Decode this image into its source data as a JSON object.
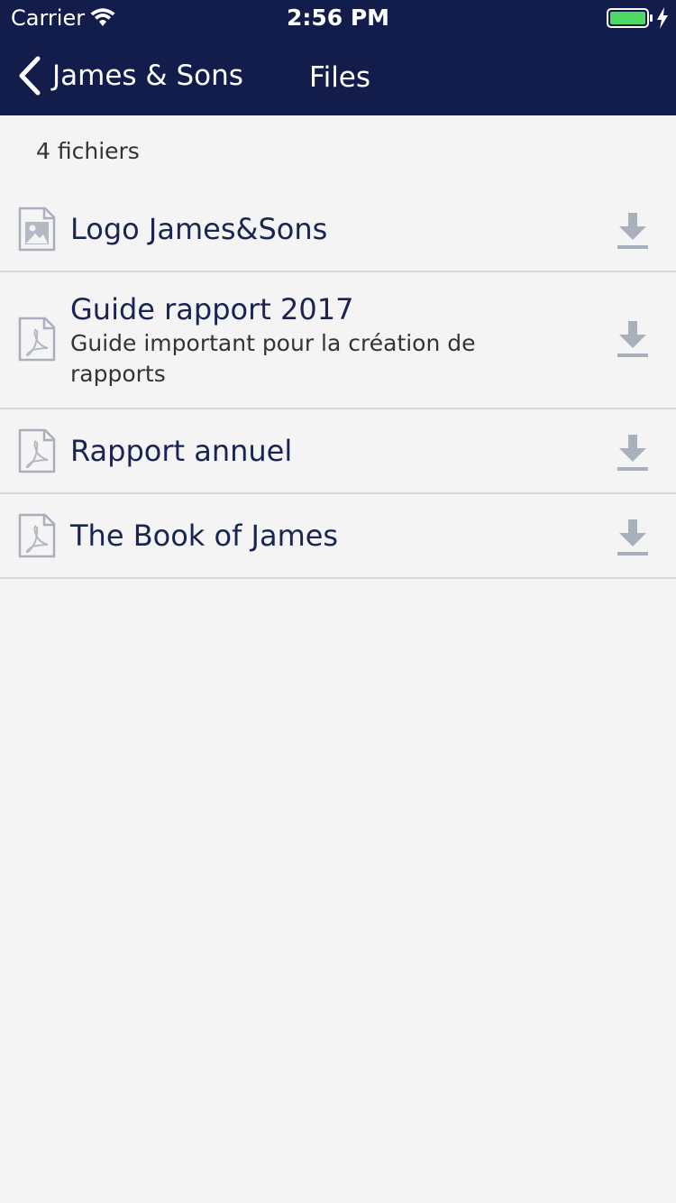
{
  "status_bar": {
    "carrier": "Carrier",
    "time": "2:56 PM",
    "battery_color": "#4cd964"
  },
  "nav": {
    "back_label": "James & Sons",
    "title": "Files",
    "background": "#121d4c"
  },
  "files": {
    "count_label": "4 fichiers",
    "items": [
      {
        "title": "Logo James&Sons",
        "description": "",
        "icon": "image-file-icon"
      },
      {
        "title": "Guide rapport 2017",
        "description": "Guide important pour la création de rapports",
        "icon": "pdf-file-icon"
      },
      {
        "title": "Rapport annuel",
        "description": "",
        "icon": "pdf-file-icon"
      },
      {
        "title": "The Book of James",
        "description": "",
        "icon": "pdf-file-icon"
      }
    ],
    "download_icon": "download-icon"
  }
}
